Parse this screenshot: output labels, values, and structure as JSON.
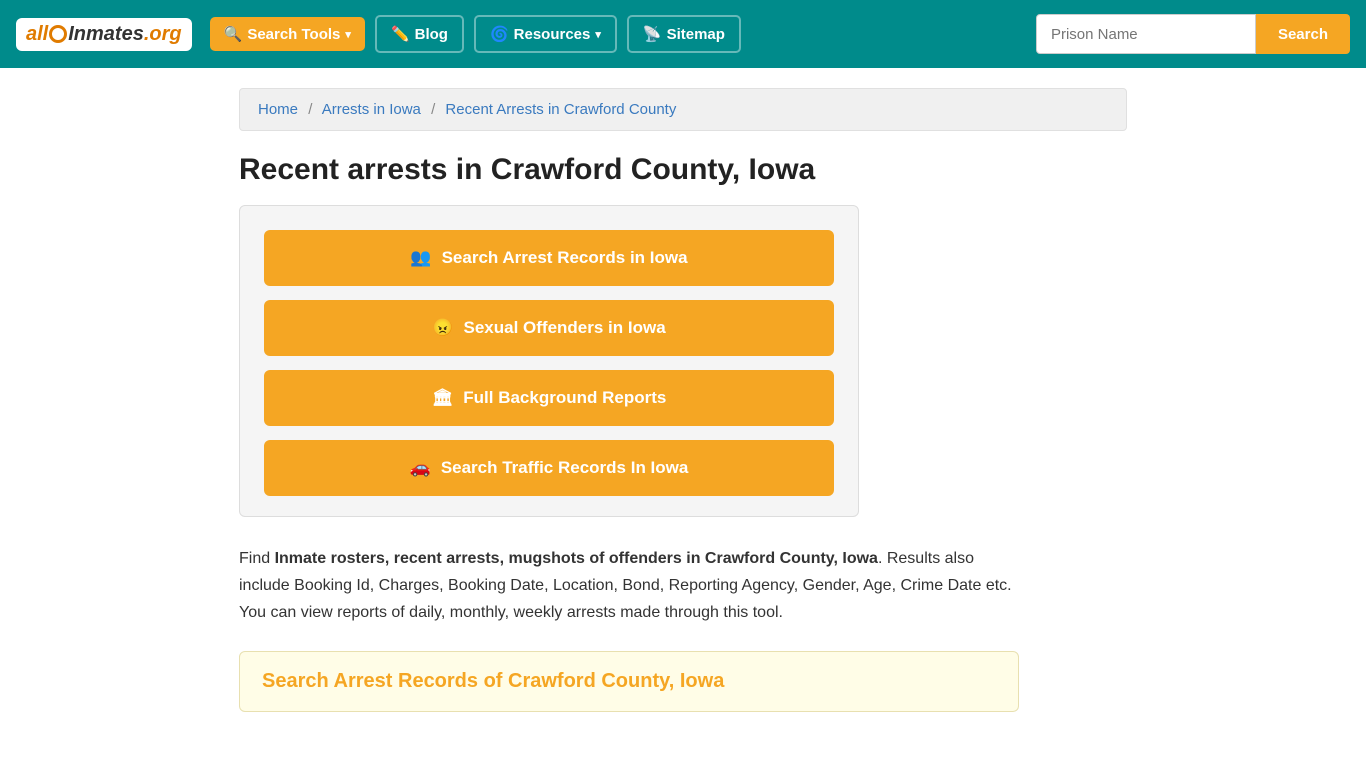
{
  "site": {
    "logo_all": "all",
    "logo_inmates": "Inmates",
    "logo_org": ".org"
  },
  "navbar": {
    "search_tools_label": "Search Tools",
    "blog_label": "Blog",
    "resources_label": "Resources",
    "sitemap_label": "Sitemap",
    "prison_name_placeholder": "Prison Name",
    "search_btn_label": "Search"
  },
  "breadcrumb": {
    "home_label": "Home",
    "arrests_iowa_label": "Arrests in Iowa",
    "current_label": "Recent Arrests in Crawford County"
  },
  "page": {
    "title": "Recent arrests in Crawford County, Iowa",
    "buttons": [
      {
        "id": "arrest-records",
        "icon": "people",
        "label": "Search Arrest Records in Iowa"
      },
      {
        "id": "sexual-offenders",
        "icon": "face",
        "label": "Sexual Offenders in Iowa"
      },
      {
        "id": "background-reports",
        "icon": "building",
        "label": "Full Background Reports"
      },
      {
        "id": "traffic-records",
        "icon": "car",
        "label": "Search Traffic Records In Iowa"
      }
    ],
    "description_intro": "Find ",
    "description_bold": "Inmate rosters, recent arrests, mugshots of offenders in Crawford County, Iowa",
    "description_rest": ". Results also include Booking Id, Charges, Booking Date, Location, Bond, Reporting Agency, Gender, Age, Crime Date etc. You can view reports of daily, monthly, weekly arrests made through this tool.",
    "search_section_title": "Search Arrest Records of Crawford County, Iowa"
  }
}
